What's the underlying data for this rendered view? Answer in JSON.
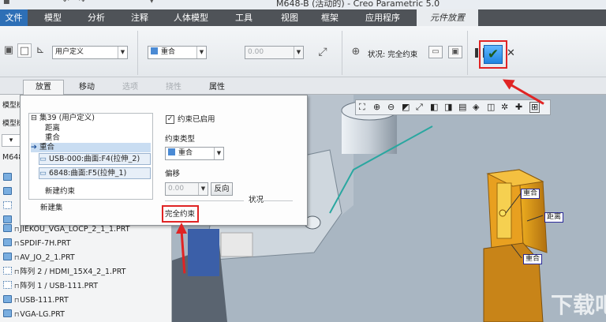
{
  "window": {
    "title": "M648-B (活动的) - Creo Parametric 5.0"
  },
  "ribbon": {
    "tabs": [
      {
        "label": "文件"
      },
      {
        "label": "模型"
      },
      {
        "label": "分析"
      },
      {
        "label": "注释"
      },
      {
        "label": "人体模型"
      },
      {
        "label": "工具"
      },
      {
        "label": "视图"
      },
      {
        "label": "框架"
      },
      {
        "label": "应用程序"
      },
      {
        "label": "元件放置"
      }
    ]
  },
  "toolbar": {
    "constraint_set_select": "用户定义",
    "constraint_type_select": "重合",
    "offset_value": "0.00",
    "status_label": "状况: 完全约束",
    "confirm_icon": "check-icon",
    "pause_icon": "pause-icon",
    "cancel_icon": "close-icon"
  },
  "subtabs": [
    {
      "label": "放置"
    },
    {
      "label": "移动"
    },
    {
      "label": "选项"
    },
    {
      "label": "挠性"
    },
    {
      "label": "属性"
    }
  ],
  "placement": {
    "set_name": "集39 (用户定义)",
    "set_children": [
      "距离",
      "重合"
    ],
    "active_constraint": "重合",
    "ref1": "USB-000:曲面:F4(拉伸_2)",
    "ref2": "6848:曲面:F5(拉伸_1)",
    "new_constraint": "新建约束",
    "new_set": "新建集",
    "enabled_label": "约束已启用",
    "type_label": "约束类型",
    "type_value": "重合",
    "offset_label": "偏移",
    "offset_value": "0.00",
    "flip_button": "反向",
    "status_group": "状况",
    "status_value": "完全约束"
  },
  "tree": {
    "header1": "模型树",
    "header2": "模型树",
    "root": "M648",
    "items": [
      "JIEKOU_VGA_LOCP_2_1_1.PRT",
      "SPDIF-7H.PRT",
      "AV_JO_2_1.PRT",
      "阵列 2 / HDMI_15X4_2_1.PRT",
      "阵列 1 / USB-111.PRT",
      "USB-111.PRT",
      "VGA-LG.PRT"
    ]
  },
  "viewport": {
    "labels": [
      "重合",
      "距离",
      "重合"
    ]
  },
  "watermark": "下载吧"
}
